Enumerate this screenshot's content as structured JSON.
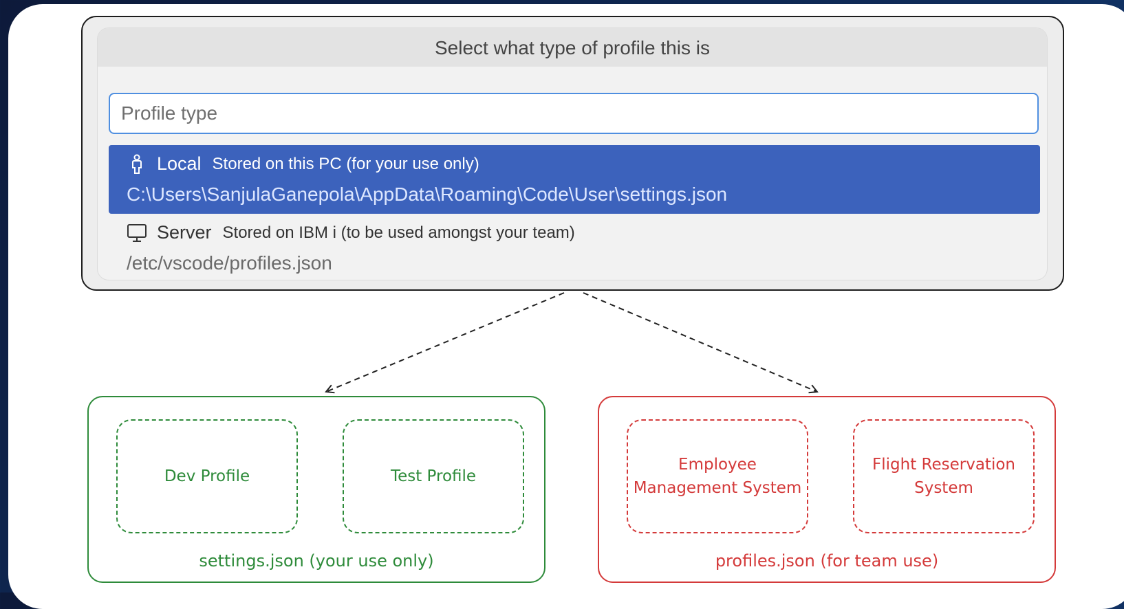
{
  "quickpick": {
    "title": "Select what type of profile this is",
    "input_placeholder": "Profile type",
    "items": [
      {
        "icon": "person-icon",
        "label": "Local",
        "description": "Stored on this PC (for your use only)",
        "detail": "C:\\Users\\SanjulaGanepola\\AppData\\Roaming\\Code\\User\\settings.json",
        "selected": true
      },
      {
        "icon": "monitor-icon",
        "label": "Server",
        "description": "Stored on IBM i (to be used amongst your team)",
        "detail": "/etc/vscode/profiles.json",
        "selected": false
      }
    ]
  },
  "diagram": {
    "local_group": {
      "color": "#2e8b3a",
      "caption": "settings.json (your use only)",
      "profiles": [
        "Dev Profile",
        "Test Profile"
      ]
    },
    "server_group": {
      "color": "#d43a3a",
      "caption": "profiles.json (for team use)",
      "profiles": [
        "Employee Management System",
        "Flight Reservation System"
      ]
    }
  },
  "colors": {
    "selection": "#3c62bc",
    "input_focus_border": "#4f8fe0"
  }
}
